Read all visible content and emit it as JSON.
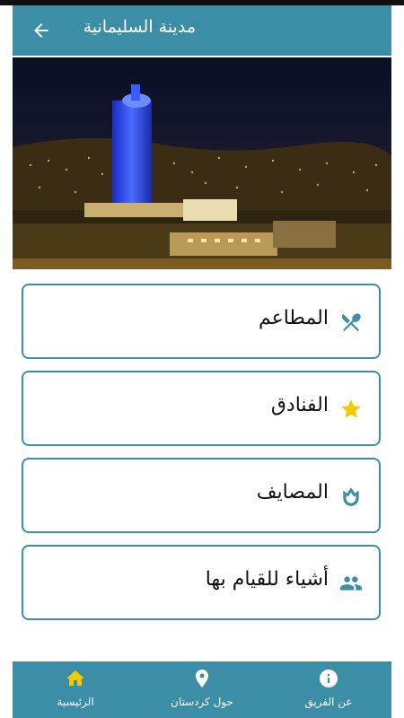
{
  "app_bar": {
    "title": "مدينة السليمانية",
    "back_icon": "arrow-back-icon"
  },
  "hero_image": {
    "description_icon": "city-night-photo"
  },
  "categories": [
    {
      "label": "المطاعم",
      "icon": "restaurant-icon",
      "icon_color": "#3b8ea5"
    },
    {
      "label": "الفنادق",
      "icon": "star-icon",
      "icon_color": "#f5c800"
    },
    {
      "label": "المصايف",
      "icon": "tulip-icon",
      "icon_color": "#3b8ea5"
    },
    {
      "label": "أشياء للقيام بها",
      "icon": "people-icon",
      "icon_color": "#3b8ea5"
    }
  ],
  "bottom_nav": [
    {
      "label": "الرئيسية",
      "icon": "home-icon",
      "icon_color": "#f5c800",
      "active": true
    },
    {
      "label": "حول كردستان",
      "icon": "location-pin-icon",
      "icon_color": "#ffffff",
      "active": false
    },
    {
      "label": "عن الفريق",
      "icon": "info-icon",
      "icon_color": "#ffffff",
      "active": false
    }
  ],
  "colors": {
    "primary": "#3b8ea5",
    "accent": "#f5c800",
    "background": "#ffffff"
  }
}
